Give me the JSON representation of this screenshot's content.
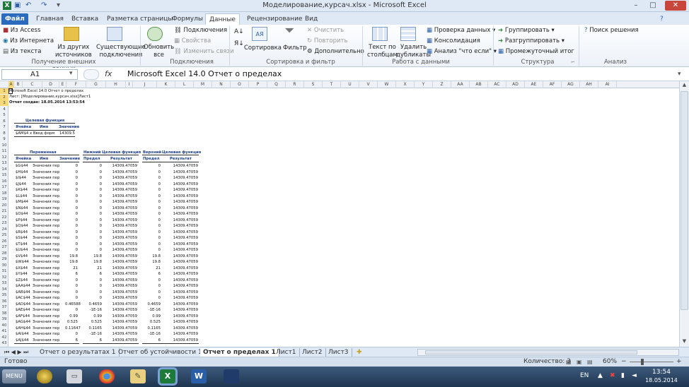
{
  "window": {
    "title": "Моделирование,курсач.xlsx - Microsoft Excel",
    "minimize": "–",
    "maximize": "□",
    "close": "✕"
  },
  "tabs": [
    "Файл",
    "Главная",
    "Вставка",
    "Разметка страницы",
    "Формулы",
    "Данные",
    "Рецензирование",
    "Вид"
  ],
  "ribbon": {
    "external": {
      "from_access": "Из Access",
      "from_web": "Из Интернета",
      "from_text": "Из текста",
      "other_sources_1": "Из других",
      "other_sources_2": "источников",
      "existing_1": "Существующие",
      "existing_2": "подключения",
      "group": "Получение внешних данных"
    },
    "connections": {
      "refresh_1": "Обновить",
      "refresh_2": "все",
      "connections": "Подключения",
      "properties": "Свойства",
      "edit_links": "Изменить связи",
      "group": "Подключения"
    },
    "sort": {
      "sort": "Сортировка",
      "filter": "Фильтр",
      "clear": "Очистить",
      "reapply": "Повторить",
      "advanced": "Дополнительно",
      "group": "Сортировка и фильтр"
    },
    "tools": {
      "text_to_cols_1": "Текст по",
      "text_to_cols_2": "столбцам",
      "remove_dup_1": "Удалить",
      "remove_dup_2": "дубликаты",
      "validation": "Проверка данных",
      "consolidate": "Консолидация",
      "whatif": "Анализ \"что если\"",
      "group": "Работа с данными"
    },
    "outline": {
      "group_btn": "Группировать",
      "ungroup_btn": "Разгруппировать",
      "subtotal": "Промежуточный итог",
      "group": "Структура"
    },
    "analysis": {
      "solver": "Поиск решения",
      "group": "Анализ"
    }
  },
  "formula_bar": {
    "name_box": "A1",
    "fx": "fx",
    "content": "Microsoft Excel 14.0 Отчет о пределах"
  },
  "columns": [
    "A",
    "B",
    "C",
    "D",
    "E",
    "F",
    "G",
    "H",
    "I",
    "J",
    "K",
    "L",
    "M",
    "N",
    "O",
    "P",
    "Q",
    "R",
    "S",
    "T",
    "U",
    "V",
    "W",
    "X",
    "Y",
    "Z",
    "AA",
    "AB",
    "AC",
    "AD",
    "AE",
    "AF",
    "AG",
    "AH",
    "AI"
  ],
  "rows": [
    "1",
    "2",
    "3",
    "4",
    "5",
    "6",
    "7",
    "8",
    "9",
    "10",
    "11",
    "12",
    "13",
    "14",
    "15",
    "16",
    "17",
    "18",
    "19",
    "20",
    "21",
    "22",
    "23",
    "24",
    "25",
    "26",
    "27",
    "28",
    "29",
    "30",
    "31",
    "32",
    "33",
    "34",
    "35",
    "36",
    "37",
    "38",
    "39",
    "40",
    "41",
    "42",
    "43"
  ],
  "report": {
    "line1": "Microsoft Excel 14.0 Отчет о пределах",
    "line2": "Лист: [Моделирование,курсач.xlsx]Лист1",
    "line3": "Отчет создан: 18.05.2014 13:53:54",
    "objective_title": "Целевая функция",
    "cell_hdr": "Ячейка",
    "name_hdr": "Имя",
    "value_hdr": "Значение",
    "objective_cell": "$AM$4",
    "objective_name": "x Ввод форм",
    "objective_value": "14309.5",
    "var_title": "Переменная",
    "lower_title": "Нижний",
    "lower_obj_title": "Целевая функция",
    "upper_title": "Верхний",
    "upper_obj_title": "Целевая функция",
    "limit_hdr": "Предел",
    "result_hdr": "Результат",
    "rows": [
      [
        "$G$44",
        "Значения пер",
        "0",
        "0",
        "14309.47059",
        "0",
        "14309.47059"
      ],
      [
        "$H$44",
        "Значения пер",
        "0",
        "0",
        "14309.47059",
        "0",
        "14309.47059"
      ],
      [
        "$I$44",
        "Значения пер",
        "0",
        "0",
        "14309.47059",
        "0",
        "14309.47059"
      ],
      [
        "$J$44",
        "Значения пер",
        "0",
        "0",
        "14309.47059",
        "0",
        "14309.47059"
      ],
      [
        "$K$44",
        "Значения пер",
        "0",
        "0",
        "14309.47059",
        "0",
        "14309.47059"
      ],
      [
        "$L$44",
        "Значения пер",
        "0",
        "0",
        "14309.47059",
        "0",
        "14309.47059"
      ],
      [
        "$M$44",
        "Значения пер",
        "0",
        "0",
        "14309.47059",
        "0",
        "14309.47059"
      ],
      [
        "$N$44",
        "Значения пер",
        "0",
        "0",
        "14309.47059",
        "0",
        "14309.47059"
      ],
      [
        "$O$44",
        "Значения пер",
        "0",
        "0",
        "14309.47059",
        "0",
        "14309.47059"
      ],
      [
        "$P$44",
        "Значения пер",
        "0",
        "0",
        "14309.47059",
        "0",
        "14309.47059"
      ],
      [
        "$Q$44",
        "Значения пер",
        "0",
        "0",
        "14309.47059",
        "0",
        "14309.47059"
      ],
      [
        "$R$44",
        "Значения пер",
        "0",
        "0",
        "14309.47059",
        "0",
        "14309.47059"
      ],
      [
        "$S$44",
        "Значения пер",
        "0",
        "0",
        "14309.47059",
        "0",
        "14309.47059"
      ],
      [
        "$T$44",
        "Значения пер",
        "0",
        "0",
        "14309.47059",
        "0",
        "14309.47059"
      ],
      [
        "$U$44",
        "Значения пер",
        "0",
        "0",
        "14309.47059",
        "0",
        "14309.47059"
      ],
      [
        "$V$44",
        "Значения пер",
        "19.8",
        "19.8",
        "14309.47059",
        "19.8",
        "14309.47059"
      ],
      [
        "$W$44",
        "Значения пер",
        "19.8",
        "19.8",
        "14309.47059",
        "19.8",
        "14309.47059"
      ],
      [
        "$X$44",
        "Значения пер",
        "21",
        "21",
        "14309.47059",
        "21",
        "14309.47059"
      ],
      [
        "$Y$44",
        "Значения пер",
        "6",
        "6",
        "14309.47059",
        "6",
        "14309.47059"
      ],
      [
        "$Z$44",
        "Значения пер",
        "0",
        "0",
        "14309.47059",
        "0",
        "14309.47059"
      ],
      [
        "$AA$44",
        "Значения пер",
        "0",
        "0",
        "14309.47059",
        "0",
        "14309.47059"
      ],
      [
        "$AB$44",
        "Значения пер",
        "0",
        "0",
        "14309.47059",
        "0",
        "14309.47059"
      ],
      [
        "$AC$44",
        "Значения пер",
        "0",
        "0",
        "14309.47059",
        "0",
        "14309.47059"
      ],
      [
        "$AD$44",
        "Значения пер",
        "0.46588",
        "0.4659",
        "14309.47059",
        "0.4659",
        "14309.47059"
      ],
      [
        "$AE$44",
        "Значения пер",
        "0",
        "-1E-16",
        "14309.47059",
        "-1E-16",
        "14309.47059"
      ],
      [
        "$AF$44",
        "Значения пер",
        "0.99",
        "0.99",
        "14309.47059",
        "0.99",
        "14309.47059"
      ],
      [
        "$AG$44",
        "Значения пер",
        "0.525",
        "0.525",
        "14309.47059",
        "0.525",
        "14309.47059"
      ],
      [
        "$AH$44",
        "Значения пер",
        "0.11647",
        "0.1165",
        "14309.47059",
        "0.1165",
        "14309.47059"
      ],
      [
        "$AI$44",
        "Значения пер",
        "0",
        "-1E-16",
        "14309.47059",
        "-1E-16",
        "14309.47059"
      ],
      [
        "$AJ$44",
        "Значения пер",
        "6",
        "6",
        "14309.47059",
        "6",
        "14309.47059"
      ]
    ]
  },
  "sheets": [
    "Отчет о результатах 1",
    "Отчет об устойчивости 1",
    "Отчет о пределах 1",
    "Лист1",
    "Лист2",
    "Лист3"
  ],
  "status": {
    "ready": "Готово",
    "count": "Количество: 3",
    "zoom": "60%"
  },
  "taskbar": {
    "menu": "MENU",
    "lang": "EN",
    "time": "13:54",
    "date": "18.05.2014"
  }
}
